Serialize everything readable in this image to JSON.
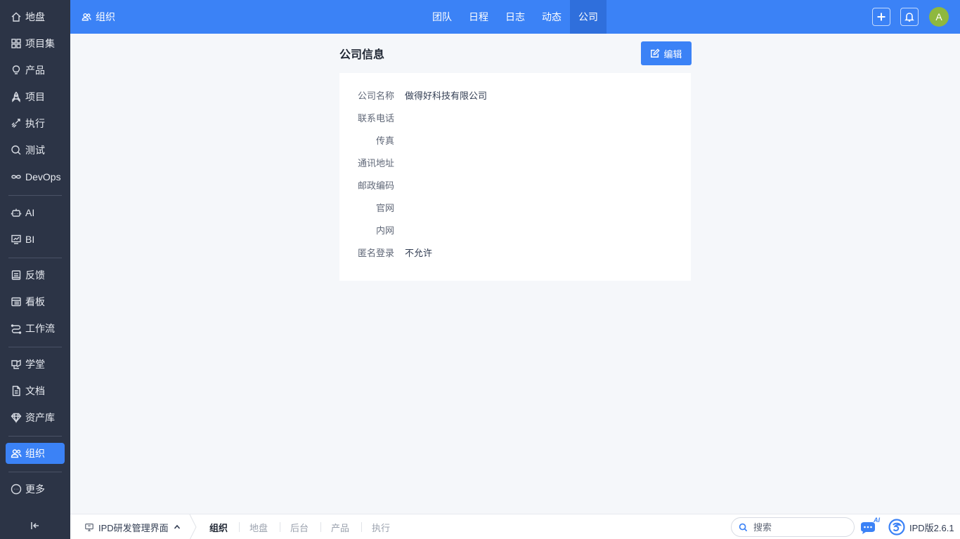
{
  "sidebar": {
    "items": [
      {
        "label": "地盘",
        "icon": "home-icon"
      },
      {
        "label": "项目集",
        "icon": "grid-icon"
      },
      {
        "label": "产品",
        "icon": "lightbulb-icon"
      },
      {
        "label": "项目",
        "icon": "rocket-icon"
      },
      {
        "label": "执行",
        "icon": "run-icon"
      },
      {
        "label": "测试",
        "icon": "search-bug-icon"
      },
      {
        "label": "DevOps",
        "icon": "infinity-icon"
      },
      {
        "label": "AI",
        "icon": "robot-icon"
      },
      {
        "label": "BI",
        "icon": "chart-icon"
      },
      {
        "label": "反馈",
        "icon": "feedback-icon"
      },
      {
        "label": "看板",
        "icon": "kanban-icon"
      },
      {
        "label": "工作流",
        "icon": "workflow-icon"
      },
      {
        "label": "学堂",
        "icon": "school-icon"
      },
      {
        "label": "文档",
        "icon": "document-icon"
      },
      {
        "label": "资产库",
        "icon": "diamond-icon"
      },
      {
        "label": "组织",
        "icon": "users-icon"
      },
      {
        "label": "更多",
        "icon": "more-icon"
      }
    ],
    "active_index": 15
  },
  "topbar": {
    "module": "组织",
    "tabs": [
      "团队",
      "日程",
      "日志",
      "动态",
      "公司"
    ],
    "active_tab": "公司",
    "avatar_letter": "A",
    "accent_color": "#3b82f6"
  },
  "main": {
    "title": "公司信息",
    "edit_label": "编辑",
    "fields": [
      {
        "label": "公司名称",
        "value": "做得好科技有限公司"
      },
      {
        "label": "联系电话",
        "value": ""
      },
      {
        "label": "传真",
        "value": ""
      },
      {
        "label": "通讯地址",
        "value": ""
      },
      {
        "label": "邮政编码",
        "value": ""
      },
      {
        "label": "官网",
        "value": ""
      },
      {
        "label": "内网",
        "value": ""
      },
      {
        "label": "匿名登录",
        "value": "不允许"
      }
    ]
  },
  "bottombar": {
    "app_name": "IPD研发管理界面",
    "crumbs": [
      "组织",
      "地盘",
      "后台",
      "产品",
      "执行"
    ],
    "active_crumb": "组织",
    "search_placeholder": "搜索",
    "ai_badge": "AI",
    "version": "IPD版2.6.1"
  }
}
